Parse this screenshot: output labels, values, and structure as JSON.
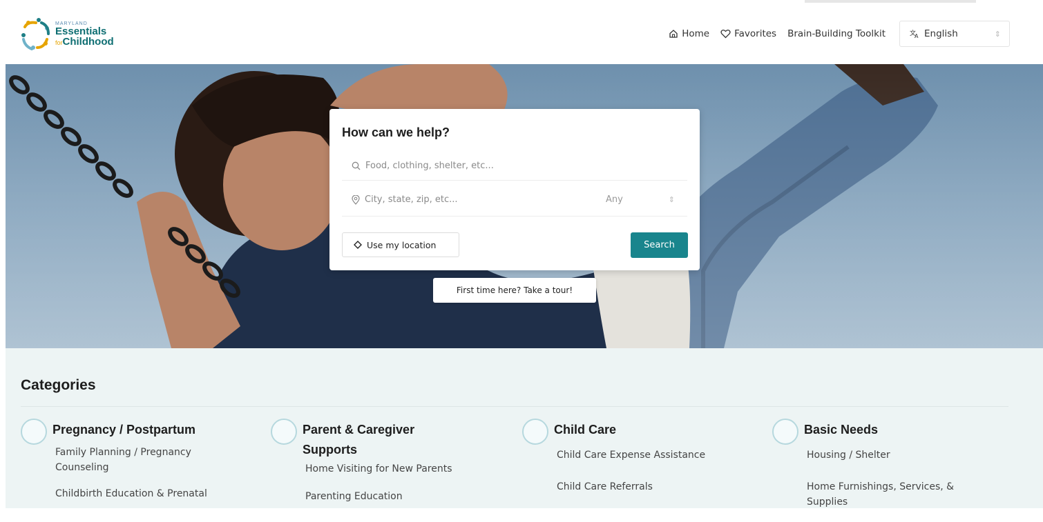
{
  "brand": {
    "logo_small": "MARYLAND",
    "logo_line1": "Essentials",
    "logo_for": "for",
    "logo_line2": "Childhood"
  },
  "nav": {
    "home": "Home",
    "favorites": "Favorites",
    "toolkit": "Brain-Building Toolkit",
    "language": "English"
  },
  "search": {
    "title": "How can we help?",
    "query_placeholder": "Food, clothing, shelter, etc...",
    "location_placeholder": "City, state, zip, etc...",
    "distance_value": "Any",
    "use_location": "Use my location",
    "search_button": "Search"
  },
  "tour": {
    "label": "First time here? Take a tour!"
  },
  "categories": {
    "title": "Categories",
    "columns": [
      {
        "name": "Pregnancy / Postpartum",
        "items": [
          "Family Planning / Pregnancy Counseling",
          "Childbirth Education & Prenatal"
        ]
      },
      {
        "name": "Parent & Caregiver Supports",
        "items": [
          "Home Visiting for New Parents",
          "Parenting Education"
        ]
      },
      {
        "name": "Child Care",
        "items": [
          "Child Care Expense Assistance",
          "Child Care Referrals"
        ]
      },
      {
        "name": "Basic Needs",
        "items": [
          "Housing / Shelter",
          "Home Furnishings, Services, & Supplies"
        ]
      }
    ]
  },
  "colors": {
    "accent": "#19858d",
    "category_bg": "#edf4f4",
    "brand_teal": "#0e6e72",
    "brand_gold": "#e6a400"
  },
  "icons": [
    "home-icon",
    "heart-icon",
    "translate-icon",
    "search-icon",
    "location-pin-icon",
    "location-diamond-icon"
  ]
}
